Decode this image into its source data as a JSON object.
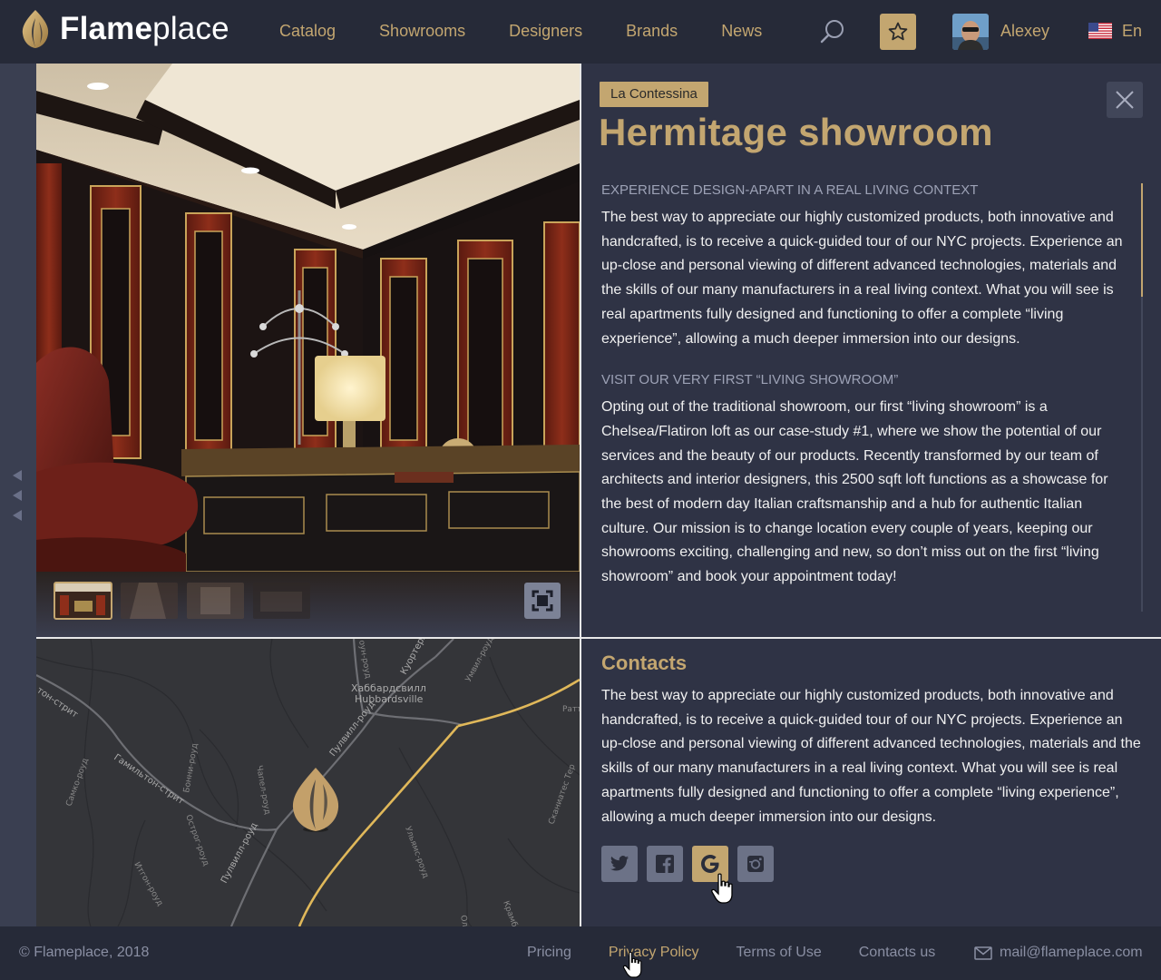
{
  "header": {
    "logo_bold": "Flame",
    "logo_light": "place",
    "nav": [
      "Catalog",
      "Showrooms",
      "Designers",
      "Brands",
      "News"
    ],
    "username": "Alexey",
    "language": "En",
    "icons": {
      "search": "search-icon",
      "favorites": "star-icon",
      "flag": "us-flag-icon"
    }
  },
  "showroom": {
    "brand": "La Contessina",
    "title": "Hermitage showroom",
    "sections": [
      {
        "heading": "EXPERIENCE DESIGN-APART IN A REAL LIVING CONTEXT",
        "text": "The best way to appreciate our highly customized products, both innovative and handcrafted, is to receive a quick-guided tour of our NYC projects. Experience an up-close and personal viewing of different advanced technologies, materials and the skills of our many manufacturers in a real living context. What you will see is real apartments fully designed and functioning to offer a complete “living experience”, allowing a much deeper immersion into our designs."
      },
      {
        "heading": "VISIT OUR VERY FIRST “LIVING SHOWROOM”",
        "text": "Opting out of the traditional showroom, our first “living showroom” is a Chelsea/Flatiron loft as our case-study #1, where we show the potential of our services and the beauty of our products. Recently transformed by our team of architects and interior designers, this 2500 sqft loft functions as a showcase for the best of modern day Italian craftsmanship and a hub for authentic Italian culture. Our mission is to change location every couple of years, keeping our showrooms exciting, challenging and new, so don’t miss out on the first “living showroom” and book your appointment today!"
      }
    ]
  },
  "gallery": {
    "thumbnail_count": 4,
    "active_index": 0
  },
  "map": {
    "labels": {
      "town_ru": "Хаббардсвилл",
      "town_en": "Hubbardsville",
      "road_hamilton": "Гамильтон-стрит",
      "road_pulvill": "Пулвилл-роуд",
      "road_pulvill2": "Пулвилл-роуд",
      "road_kuortel": "Куортерл",
      "road_umvil": "Умвил-роуд",
      "road_bonney": "Бонни-роуд",
      "road_chapel": "Чапел-роуд",
      "road_samco": "Самко-роуд",
      "road_ostrog": "Острог-роуд",
      "road_itgon": "Итгон-роуд",
      "road_ulrams": "Ульямс-роуд",
      "road_skaneates": "Сканиатес Тер",
      "road_rattl": "Ратт",
      "road_ton": "тон-стрит",
      "road_krams": "Крамб",
      "road_ol": "Ол",
      "road_north": "оун-роуд"
    }
  },
  "contacts": {
    "title": "Contacts",
    "text": "The best way to appreciate our highly customized products, both innovative and handcrafted, is to receive a quick-guided tour of our NYC projects. Experience an up-close and personal viewing of different advanced technologies, materials and the skills of our many manufacturers in a real living context. What you will see is real apartments fully designed and functioning to offer a complete “living experience”, allowing a much deeper immersion into our designs.",
    "socials": [
      "twitter-icon",
      "facebook-icon",
      "google-icon",
      "instagram-icon"
    ]
  },
  "footer": {
    "copyright": "© Flameplace, 2018",
    "links": [
      "Pricing",
      "Privacy Policy",
      "Terms of Use",
      "Contacts us"
    ],
    "email": "mail@flameplace.com"
  },
  "colors": {
    "accent": "#c3a670",
    "header_bg": "#262a38",
    "panel_bg": "#2f3345",
    "muted": "#8a8fa3"
  }
}
